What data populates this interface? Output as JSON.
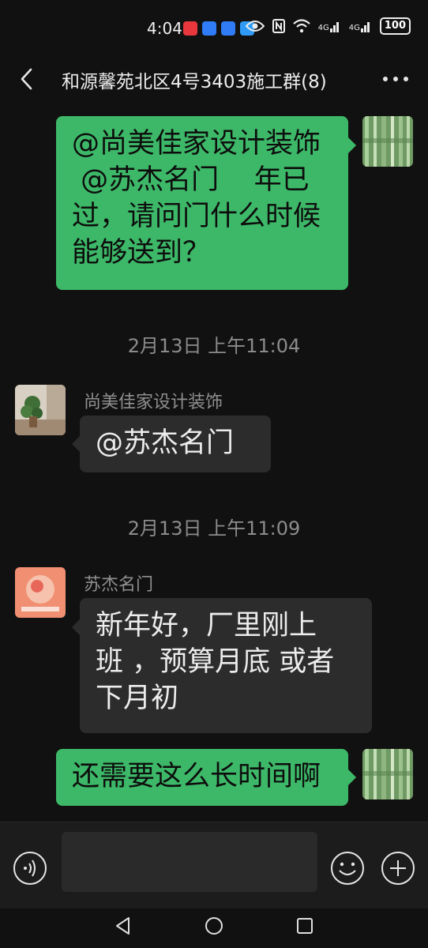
{
  "status_bar": {
    "time": "4:04",
    "battery": "100",
    "network_1": "4G",
    "network_2": "4G"
  },
  "header": {
    "title": "和源馨苑北区4号3403施工群(8)"
  },
  "messages": [
    {
      "sender": "",
      "side": "right",
      "text_lines": [
        "@尚美佳家设计装饰",
        " @苏杰名门    年已",
        "过，请问门什么时候",
        "能够送到？"
      ]
    },
    {
      "timestamp": "2月13日 上午11:04"
    },
    {
      "sender": "尚美佳家设计装饰",
      "side": "left",
      "text_lines": [
        "@苏杰名门"
      ]
    },
    {
      "timestamp": "2月13日 上午11:09"
    },
    {
      "sender": "苏杰名门",
      "side": "left",
      "text_lines": [
        "新年好，厂里刚上",
        "班 ，预算月底 或者",
        "下月初"
      ]
    },
    {
      "sender": "",
      "side": "right",
      "text_lines": [
        "还需要这么长时间啊"
      ]
    }
  ],
  "colors": {
    "background": "#111111",
    "sent_bubble": "#3db868",
    "received_bubble": "#2c2c2c"
  }
}
